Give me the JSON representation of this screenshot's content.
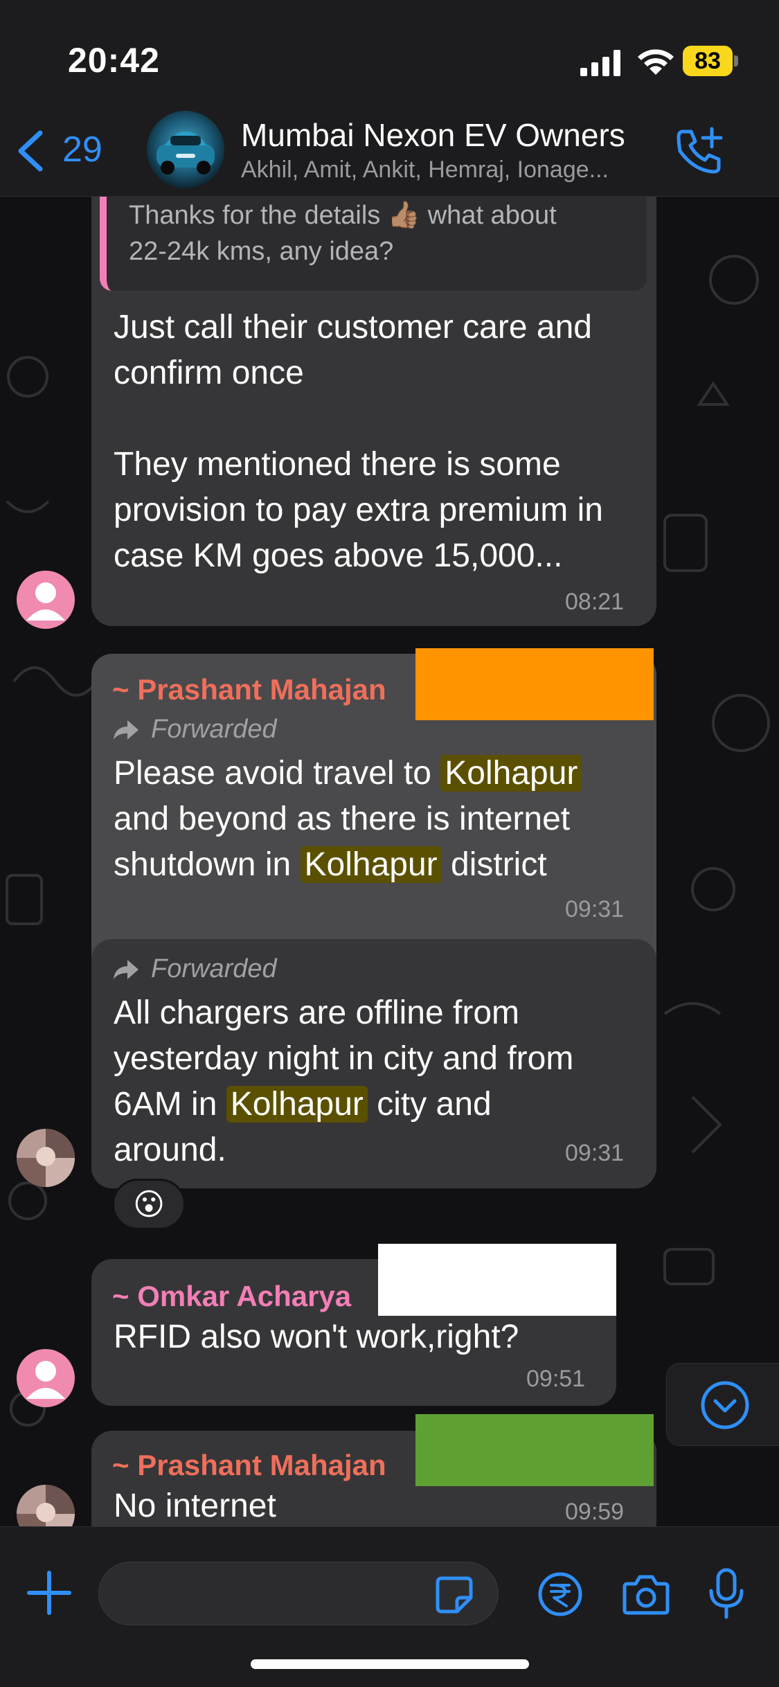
{
  "status_bar": {
    "time": "20:42",
    "battery": "83"
  },
  "header": {
    "back_count": "29",
    "title": "Mumbai Nexon EV Owners",
    "subtitle": "Akhil, Amit, Ankit, Hemraj, Ionage..."
  },
  "colors": {
    "accent": "#2f8ff7",
    "sender_prashant": "#ef6f5b",
    "sender_omkar": "#f27fb5",
    "highlight": "#5b5000",
    "redact_orange": "#ff9400",
    "redact_white": "#ffffff",
    "redact_green": "#5fa033"
  },
  "messages": {
    "m1": {
      "quote_text_1": "Thanks for the details 👍🏽 what about",
      "quote_text_2": "22-24k kms, any idea?",
      "line1": "Just call their customer care and",
      "line2": "confirm once",
      "line3": "They mentioned there is some",
      "line4": "provision to pay extra premium in",
      "line5": "case KM goes above 15,000...",
      "time": "08:21"
    },
    "m2": {
      "sender": "~ Prashant Mahajan",
      "forwarded": "Forwarded",
      "l1a": "Please avoid travel to ",
      "l1b": "Kolhapur",
      "l2": "and beyond as there is internet",
      "l3a": "shutdown in ",
      "l3b": "Kolhapur",
      "l3c": " district",
      "time": "09:31"
    },
    "m3": {
      "forwarded": "Forwarded",
      "l1": "All chargers are offline from",
      "l2": "yesterday night in city and from",
      "l3a": "6AM in ",
      "l3b": "Kolhapur",
      "l3c": " city and",
      "l4": "around.",
      "time": "09:31",
      "reaction": "😮"
    },
    "m4": {
      "sender": "~ Omkar Acharya",
      "text": "RFID also won't work,right?",
      "time": "09:51"
    },
    "m5": {
      "sender": "~ Prashant Mahajan",
      "text": "No internet",
      "time": "09:59"
    }
  },
  "input": {
    "placeholder": "",
    "value": ""
  },
  "icons": [
    "back-chevron-icon",
    "signal-icon",
    "wifi-icon",
    "battery-icon",
    "add-call-icon",
    "forward-icon",
    "plus-icon",
    "sticker-icon",
    "rupee-payment-icon",
    "camera-icon",
    "microphone-icon",
    "scroll-down-icon"
  ]
}
